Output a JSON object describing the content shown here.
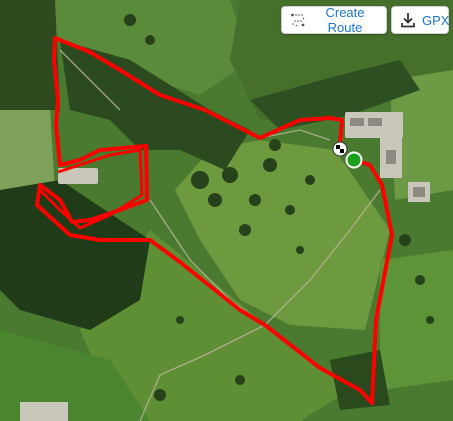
{
  "toolbar": {
    "create_route_label": "Create Route",
    "gpx_label": "GPX"
  },
  "icons": {
    "create_route": "route-dots-icon",
    "gpx": "download-icon",
    "start_marker": "start-flag-icon",
    "end_marker": "finish-dot-icon"
  },
  "colors": {
    "route": "#ff0000",
    "start_marker_fill": "#1aa31a",
    "button_text": "#1976d2"
  }
}
